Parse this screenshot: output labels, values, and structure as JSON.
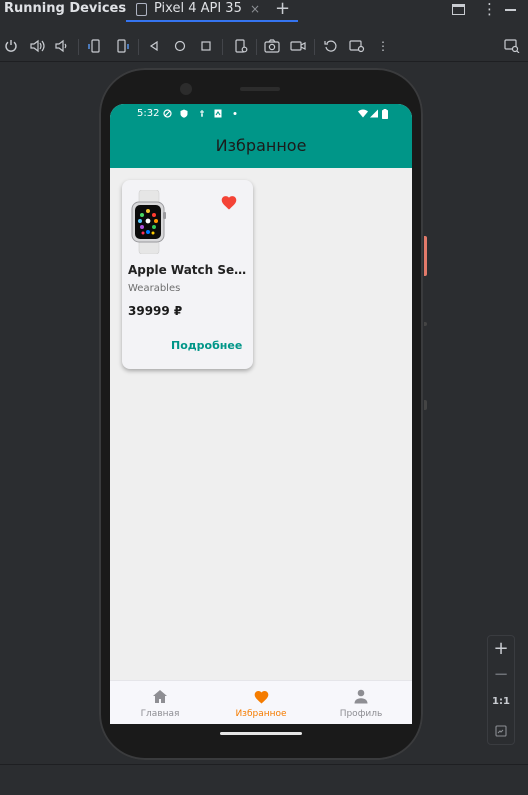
{
  "window": {
    "panel_title": "Running Devices",
    "tab_label": "Pixel 4 API 35",
    "tab_close": "×",
    "add_tab": "+",
    "more": "⋮"
  },
  "toolbar": {
    "icons": [
      "power-icon",
      "volume-up-icon",
      "volume-down-icon",
      "rotate-left-icon",
      "rotate-right-icon",
      "back-icon",
      "home-icon",
      "overview-icon",
      "device-settings-icon",
      "screenshot-icon",
      "screen-record-icon",
      "reset-icon",
      "snapshot-icon",
      "more-icon",
      "device-explorer-icon"
    ]
  },
  "device": {
    "status": {
      "time": "5:32"
    },
    "app_title": "Избранное",
    "favorites": [
      {
        "name": "Apple Watch Serie…",
        "category": "Wearables",
        "price": "39999 ₽",
        "more_label": "Подробнее",
        "favorite": true
      }
    ],
    "bottom_nav": [
      {
        "label": "Главная",
        "icon": "home-icon",
        "active": false
      },
      {
        "label": "Избранное",
        "icon": "heart-icon",
        "active": true
      },
      {
        "label": "Профиль",
        "icon": "person-icon",
        "active": false
      }
    ]
  },
  "zoom": {
    "zoom_in": "+",
    "zoom_out": "−",
    "actual_size": "1:1"
  },
  "colors": {
    "teal": "#009688",
    "accent_orange": "#f57c00",
    "heart_red": "#f44336"
  }
}
